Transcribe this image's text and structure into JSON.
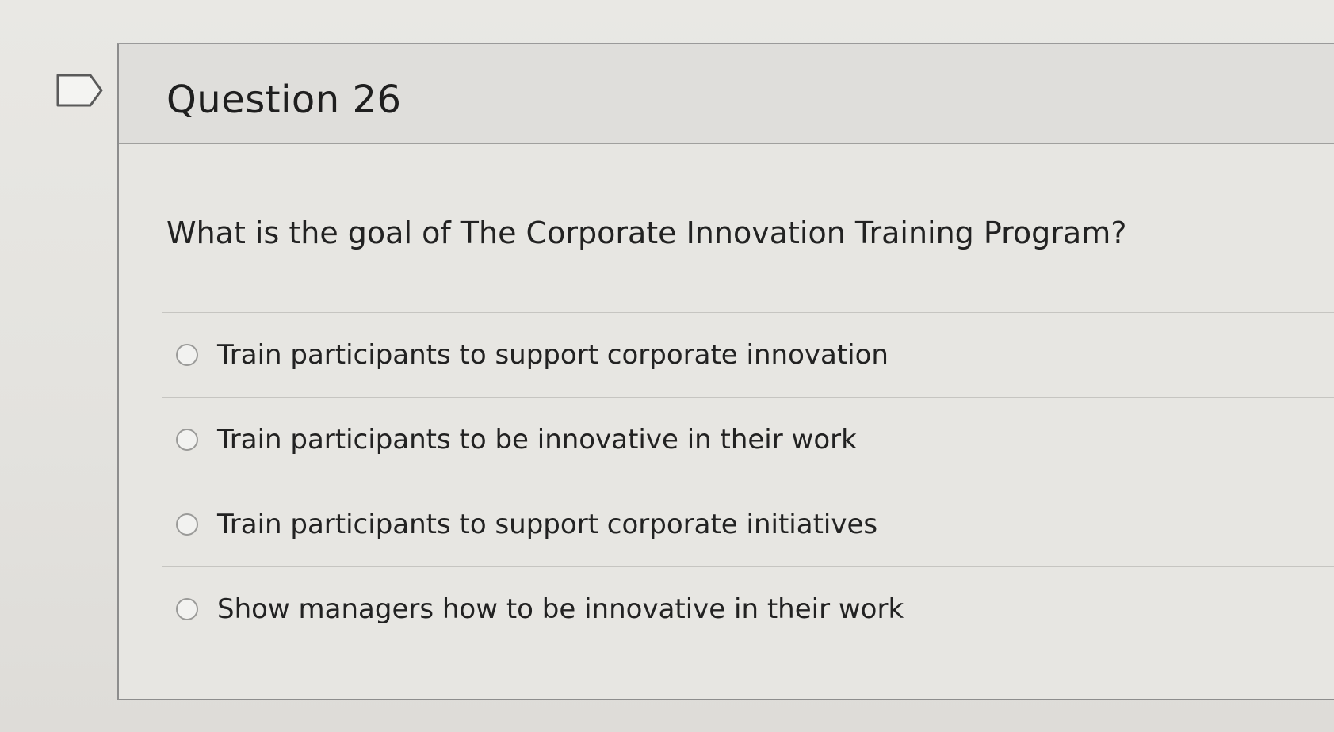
{
  "question": {
    "title": "Question 26",
    "text": "What is the goal of The Corporate Innovation Training Program?",
    "options": [
      {
        "label": "Train participants to support corporate innovation"
      },
      {
        "label": "Train participants to be innovative in their work"
      },
      {
        "label": "Train participants to support corporate initiatives"
      },
      {
        "label": "Show managers how to be innovative in their work"
      }
    ]
  },
  "icons": {
    "flag": "flag-icon",
    "radio": "radio-unselected-icon"
  },
  "colors": {
    "background": "#e6e5e1",
    "header": "#dfdedb",
    "border": "#8d8d8d",
    "text": "#222222"
  }
}
